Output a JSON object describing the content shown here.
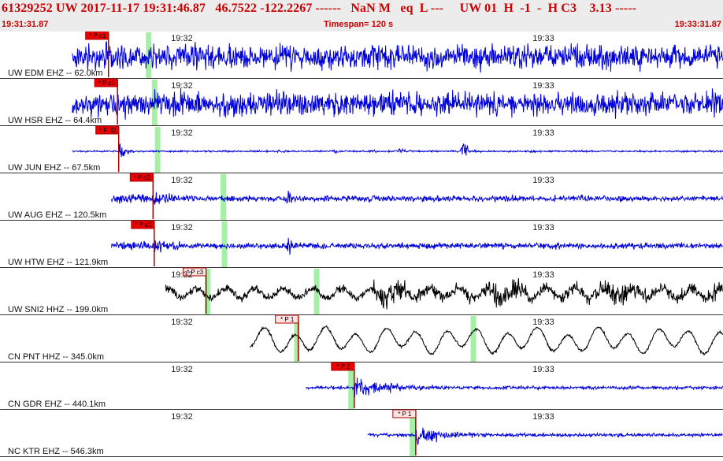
{
  "header": {
    "title": "61329252 UW 2017-11-17 19:31:46.87   46.7522 -122.2267 ------   NaN M   eq  L ---     UW 01  H  -1  -  H C3    3.13 -----",
    "start_time": "19:31:31.87",
    "timespan": "Timespan= 120 s",
    "end_time": "19:33:31.87",
    "color": "#cc0000"
  },
  "minute_labels": [
    "19:32",
    "19:33"
  ],
  "colors": {
    "trace_blue": "#0000dd",
    "trace_black": "#000000",
    "pick_line": "#aa0000",
    "pick_box_active": "#ee0000",
    "pick_box_inactive": "#ffe2e2",
    "arrival_band": "#a6f0a6"
  },
  "traces": [
    {
      "label": "UW EDM EHZ -- 62.0km",
      "pick": "P c1",
      "pick_active": true,
      "color": "blue",
      "start_s": 12.0,
      "pick_s": 18.0,
      "arrival_s": [
        24.6
      ],
      "style": "dense"
    },
    {
      "label": "UW HSR EHZ -- 64.4km",
      "pick": "P c1",
      "pick_active": true,
      "color": "blue",
      "start_s": 12.0,
      "pick_s": 19.5,
      "arrival_s": [
        25.6
      ],
      "style": "dense"
    },
    {
      "label": "UW JUN EHZ -- 67.5km",
      "pick": "P d2",
      "pick_active": true,
      "color": "blue",
      "start_s": 12.0,
      "pick_s": 19.7,
      "arrival_s": [
        26.1
      ],
      "style": "quiet"
    },
    {
      "label": "UW AUG EHZ -- 120.5km",
      "pick": "P d2",
      "pick_active": true,
      "color": "blue",
      "start_s": 18.5,
      "pick_s": 25.4,
      "arrival_s": [
        37.0
      ],
      "style": "medium"
    },
    {
      "label": "UW HTW EHZ -- 121.9km",
      "pick": "P d2",
      "pick_active": true,
      "color": "blue",
      "start_s": 18.5,
      "pick_s": 25.6,
      "arrival_s": [
        37.2
      ],
      "style": "medium"
    },
    {
      "label": "UW SNI2 HHZ -- 199.0km",
      "pick": "P c3",
      "pick_active": false,
      "color": "black",
      "start_s": 27.5,
      "pick_s": 34.2,
      "arrival_s": [
        34.4,
        52.5
      ],
      "style": "surface"
    },
    {
      "label": "CN PNT HHZ -- 345.0km",
      "pick": "P 1",
      "pick_active": false,
      "color": "black",
      "start_s": 41.5,
      "pick_s": 49.5,
      "arrival_s": [
        49.2,
        78.5
      ],
      "style": "long"
    },
    {
      "label": "CN GDR EHZ -- 440.1km",
      "pick": "P 2",
      "pick_active": true,
      "color": "blue",
      "start_s": 50.8,
      "pick_s": 58.8,
      "arrival_s": [
        58.2
      ],
      "style": "event"
    },
    {
      "label": "NC KTR EHZ -- 546.3km",
      "pick": "P 1",
      "pick_active": false,
      "color": "blue",
      "start_s": 61.0,
      "pick_s": 69.0,
      "arrival_s": [
        68.4
      ],
      "style": "event"
    }
  ]
}
